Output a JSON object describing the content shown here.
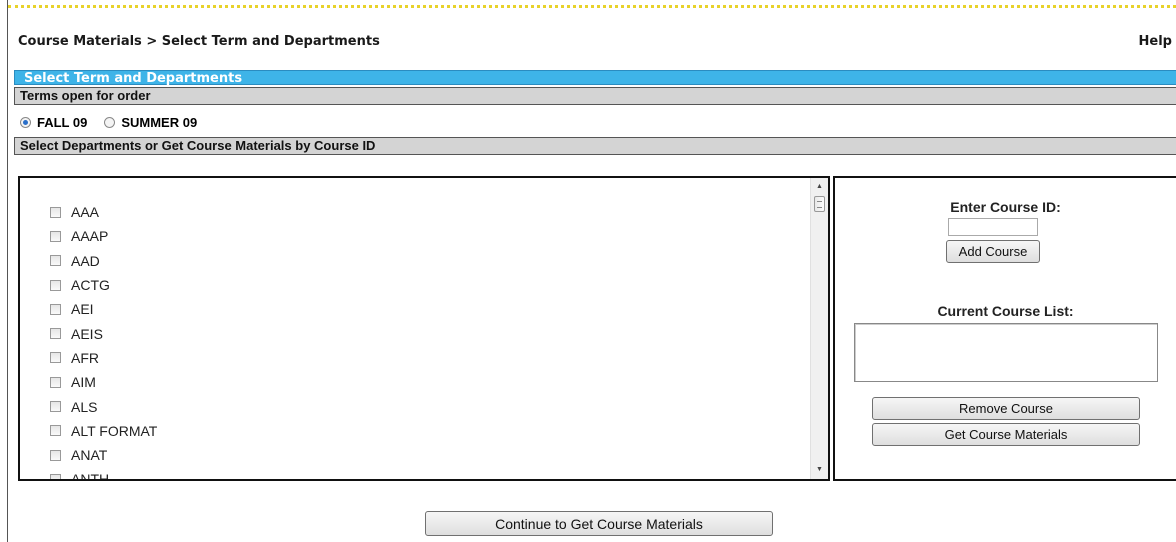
{
  "header": {
    "breadcrumb": "Course Materials > Select Term and Departments",
    "help_label": "Help"
  },
  "section_title": "Select Term and Departments",
  "terms": {
    "heading": "Terms open for order",
    "options": [
      {
        "label": "FALL 09",
        "selected": true
      },
      {
        "label": "SUMMER 09",
        "selected": false
      }
    ]
  },
  "departments": {
    "heading": "Select Departments or Get Course Materials by Course ID",
    "items": [
      "AAA",
      "AAAP",
      "AAD",
      "ACTG",
      "AEI",
      "AEIS",
      "AFR",
      "AIM",
      "ALS",
      "ALT FORMAT",
      "ANAT",
      "ANTH"
    ]
  },
  "course_panel": {
    "enter_label": "Enter Course ID:",
    "input_value": "",
    "add_button": "Add Course",
    "current_list_label": "Current Course List:",
    "remove_button": "Remove Course",
    "get_button": "Get Course Materials"
  },
  "continue_button": "Continue to Get Course Materials",
  "colors": {
    "title_bar": "#3eb4e8",
    "section_bar": "#d4d4d4",
    "dotted_rule": "#e8d22a"
  }
}
